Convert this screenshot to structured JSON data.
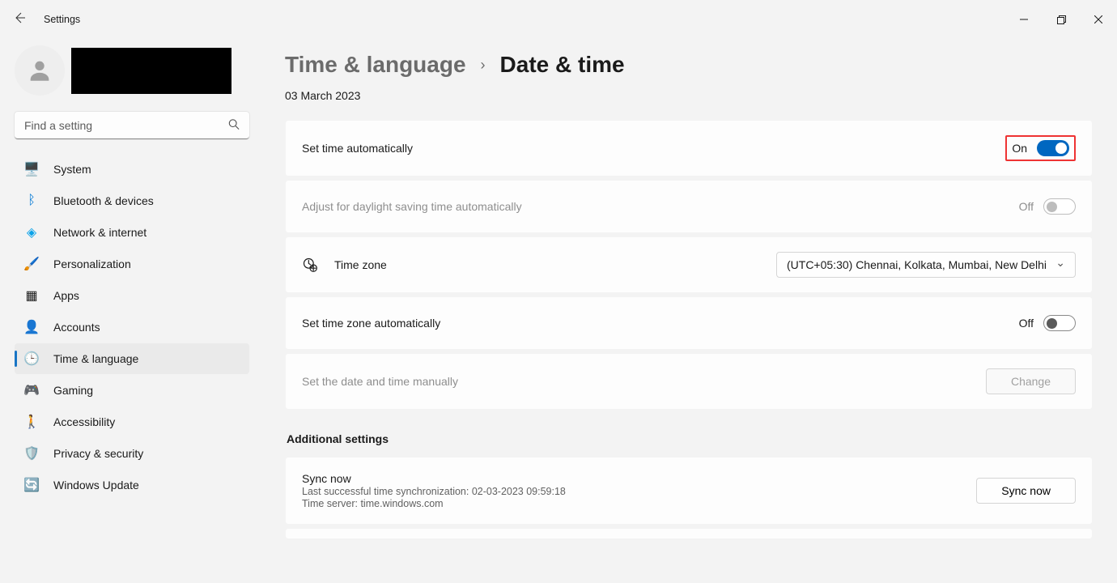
{
  "app": {
    "title": "Settings"
  },
  "search": {
    "placeholder": "Find a setting"
  },
  "nav": {
    "items": [
      {
        "label": "System"
      },
      {
        "label": "Bluetooth & devices"
      },
      {
        "label": "Network & internet"
      },
      {
        "label": "Personalization"
      },
      {
        "label": "Apps"
      },
      {
        "label": "Accounts"
      },
      {
        "label": "Time & language"
      },
      {
        "label": "Gaming"
      },
      {
        "label": "Accessibility"
      },
      {
        "label": "Privacy & security"
      },
      {
        "label": "Windows Update"
      }
    ],
    "active_index": 6
  },
  "breadcrumb": {
    "parent": "Time & language",
    "current": "Date & time"
  },
  "date": "03 March 2023",
  "settings": {
    "auto_time": {
      "label": "Set time automatically",
      "state": "On"
    },
    "dst": {
      "label": "Adjust for daylight saving time automatically",
      "state": "Off"
    },
    "timezone": {
      "label": "Time zone",
      "value": "(UTC+05:30) Chennai, Kolkata, Mumbai, New Delhi"
    },
    "auto_tz": {
      "label": "Set time zone automatically",
      "state": "Off"
    },
    "manual": {
      "label": "Set the date and time manually",
      "button": "Change"
    }
  },
  "additional": {
    "title": "Additional settings",
    "sync": {
      "title": "Sync now",
      "line1": "Last successful time synchronization: 02-03-2023 09:59:18",
      "line2": "Time server: time.windows.com",
      "button": "Sync now"
    }
  }
}
